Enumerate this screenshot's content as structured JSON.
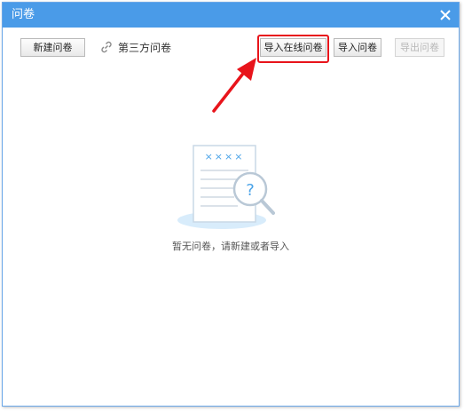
{
  "window": {
    "title": "问卷"
  },
  "toolbar": {
    "new_survey_label": "新建问卷",
    "third_party_label": "第三方问卷",
    "import_online_label": "导入在线问卷",
    "import_label": "导入问卷",
    "export_label": "导出问卷"
  },
  "empty_state": {
    "message": "暂无问卷，请新建或者导入",
    "marks": "××××",
    "question_mark": "?"
  },
  "icons": {
    "close": "close-icon",
    "link": "link-icon",
    "arrow": "annotation-arrow-icon"
  },
  "colors": {
    "titlebar": "#4a9be8",
    "highlight": "#e8141b",
    "illustration_accent": "#4aa3e8"
  }
}
